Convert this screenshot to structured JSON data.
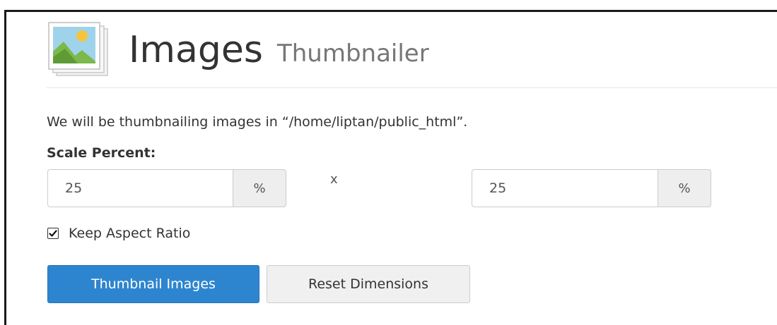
{
  "header": {
    "title": "Images",
    "subtitle": "Thumbnailer",
    "icon": "images-app-icon"
  },
  "intro_text": "We will be thumbnailing images in “/home/liptan/public_html”.",
  "scale": {
    "label": "Scale Percent:",
    "width_value": "25",
    "width_unit": "%",
    "separator": "x",
    "height_value": "25",
    "height_unit": "%"
  },
  "keep_aspect": {
    "label": "Keep Aspect Ratio",
    "checked": true
  },
  "buttons": {
    "submit_label": "Thumbnail Images",
    "reset_label": "Reset Dimensions"
  },
  "colors": {
    "primary": "#2e85cf",
    "text": "#333333",
    "subtitle": "#767676",
    "addon_bg": "#eeeeee",
    "border": "#cccccc"
  }
}
